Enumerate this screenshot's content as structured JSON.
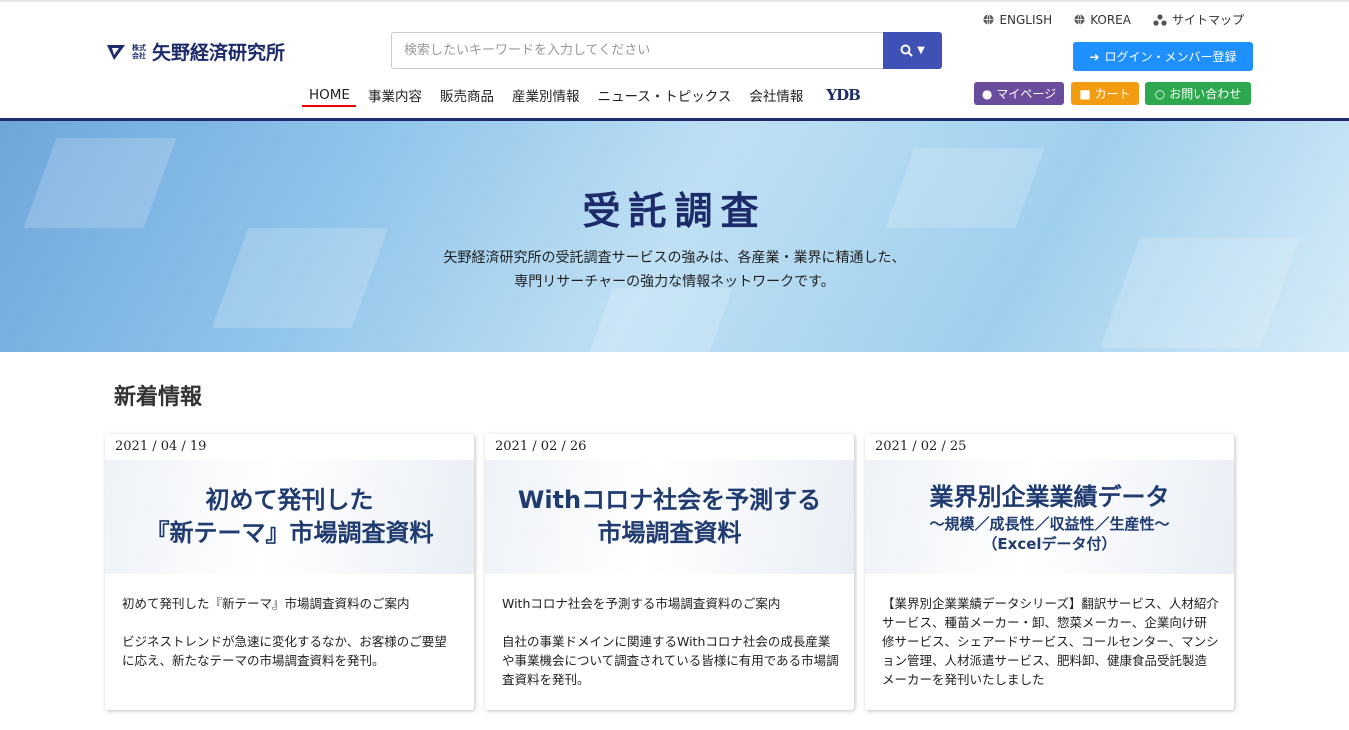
{
  "header": {
    "logo_small_1": "株式",
    "logo_small_2": "会社",
    "logo_text": "矢野経済研究所",
    "search_placeholder": "検索したいキーワードを入力してください",
    "toplinks": [
      "ENGLISH",
      "KOREA",
      "サイトマップ"
    ],
    "login_label": "ログイン・メンバー登録",
    "nav": [
      "HOME",
      "事業内容",
      "販売商品",
      "産業別情報",
      "ニュース・トピックス",
      "会社情報"
    ],
    "nav_logo": "YDB",
    "mypage_label": "マイページ",
    "cart_label": "カート",
    "contact_label": "お問い合わせ"
  },
  "hero": {
    "title": "受託調査",
    "desc_line1": "矢野経済研究所の受託調査サービスの強みは、各産業・業界に精通した、",
    "desc_line2": "専門リサーチャーの強力な情報ネットワークです。"
  },
  "news": {
    "title": "新着情報",
    "cards": [
      {
        "date": "2021 / 04 / 19",
        "img_line1": "初めて発刊した",
        "img_line2": "『新テーマ』市場調査資料",
        "text1": "初めて発刊した『新テーマ』市場調査資料のご案内",
        "text2": "ビジネストレンドが急速に変化するなか、お客様のご要望に応え、新たなテーマの市場調査資料を発刊。"
      },
      {
        "date": "2021 / 02 / 26",
        "img_line1": "Withコロナ社会を予測する",
        "img_line2": "市場調査資料",
        "text1": "Withコロナ社会を予測する市場調査資料のご案内",
        "text2": "自社の事業ドメインに関連するWithコロナ社会の成長産業や事業機会について調査されている皆様に有用である市場調査資料を発刊。"
      },
      {
        "date": "2021 / 02 / 25",
        "img_line1": "業界別企業業績データ",
        "img_line2": "～規模／成長性／収益性／生産性～",
        "img_line3": "（Excelデータ付）",
        "text1": "【業界別企業業績データシリーズ】翻訳サービス、人材紹介サービス、種苗メーカー・卸、惣菜メーカー、企業向け研修サービス、シェアードサービス、コールセンター、マンション管理、人材派遣サービス、肥料卸、健康食品受託製造メーカーを発刊いたしました"
      }
    ]
  },
  "colors": {
    "brand_navy": "#1d2b6b",
    "search_button": "#3f51b5",
    "login_button": "#1e90ff",
    "mypage": "#6a4c9c",
    "cart": "#f39c12",
    "contact": "#2ea84f",
    "active_underline": "#ee0000"
  }
}
